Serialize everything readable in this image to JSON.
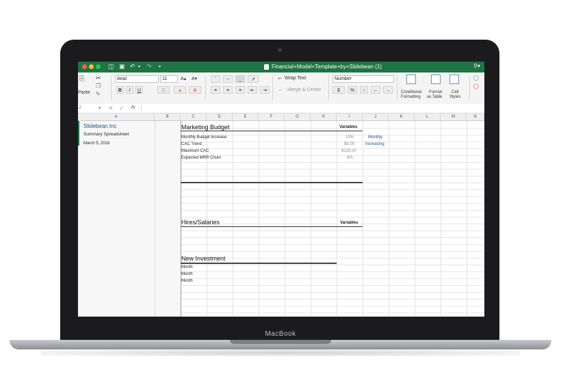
{
  "device": {
    "brand": "MacBook"
  },
  "window": {
    "title": "Financial+Model+Template+by+Slidebean (1)",
    "traffic_colors": [
      "#ff5f57",
      "#febc2e",
      "#28c840"
    ]
  },
  "toolbar": {
    "paste_label": "Paste",
    "font_name": "Arial",
    "font_size": "11",
    "grow_font": "A▴",
    "shrink_font": "A▾",
    "bold": "B",
    "italic": "I",
    "underline": "U",
    "wrap_text": "Wrap Text",
    "merge_center": "Merge & Center",
    "number_format": "Number",
    "currency": "$",
    "percent": "%",
    "comma": "›",
    "conditional_formatting_1": "Conditional",
    "conditional_formatting_2": "Formatting",
    "format_table_1": "Format",
    "format_table_2": "as Table",
    "cell_styles_1": "Cell",
    "cell_styles_2": "Styles"
  },
  "formula_bar": {
    "cell_ref": "2",
    "fx": "fx"
  },
  "columns": [
    "A",
    "B",
    "C",
    "D",
    "E",
    "F",
    "G",
    "H",
    "I",
    "J",
    "K",
    "L",
    "M",
    "N"
  ],
  "sidebar": {
    "company": "Slidebean Inc",
    "subtitle": "Summary Spreadsheet",
    "date": "March 5, 2018"
  },
  "sections": {
    "marketing": {
      "title": "Marketing Budget",
      "variables_label": "Variables",
      "rows": [
        {
          "label": "Monthly Budget Increase",
          "value": "10%",
          "note": "Monthly"
        },
        {
          "label": "CAC Trend",
          "value": "$5.00",
          "note": "Increasing"
        },
        {
          "label": "Maximum CAC",
          "value": "$125.00",
          "note": ""
        },
        {
          "label": "Expected MRR Churn",
          "value": "8%",
          "note": ""
        }
      ]
    },
    "hires": {
      "title": "Hires/Salaries",
      "variables_label": "Variables"
    },
    "investment": {
      "title": "New Investment",
      "rows": [
        "Month",
        "Month",
        "Month"
      ]
    }
  },
  "colors": {
    "excel_green": "#1f7344",
    "note_blue": "#1f4e8c",
    "muted_value": "#8a8a8a"
  }
}
